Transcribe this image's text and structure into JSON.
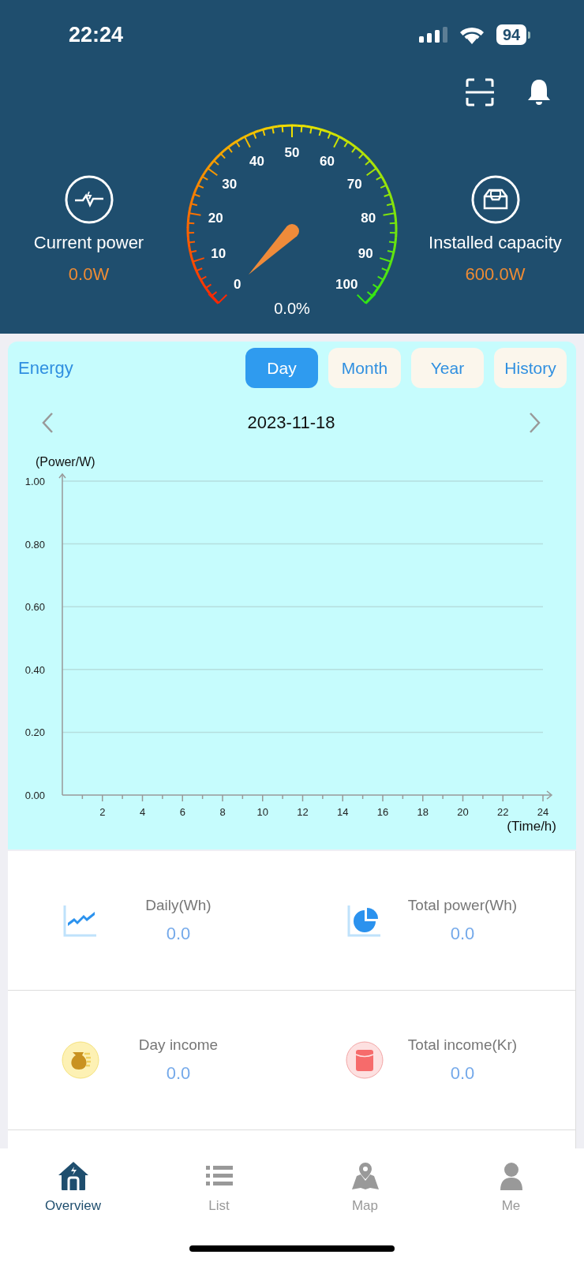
{
  "status_bar": {
    "time": "22:24",
    "battery": "94"
  },
  "gauge": {
    "scale_labels": [
      "0",
      "10",
      "20",
      "30",
      "40",
      "50",
      "60",
      "70",
      "80",
      "90",
      "100"
    ],
    "reading": "0.0%"
  },
  "current_power": {
    "label": "Current power",
    "value": "0.0W"
  },
  "installed_capacity": {
    "label": "Installed capacity",
    "value": "600.0W"
  },
  "energy": {
    "title": "Energy",
    "tabs": [
      {
        "label": "Day",
        "selected": true
      },
      {
        "label": "Month",
        "selected": false
      },
      {
        "label": "Year",
        "selected": false
      },
      {
        "label": "History",
        "selected": false
      }
    ],
    "date": "2023-11-18",
    "chart_data": {
      "type": "line",
      "grid": true,
      "xlabel": "(Time/h)",
      "ylabel": "(Power/W)",
      "xlim": [
        0,
        24
      ],
      "ylim": [
        0,
        1
      ],
      "xticks": [
        2,
        4,
        6,
        8,
        10,
        12,
        14,
        16,
        18,
        20,
        22,
        24
      ],
      "yticks": [
        {
          "value": 0,
          "label": "0.00"
        },
        {
          "value": 0.2,
          "label": "0.20"
        },
        {
          "value": 0.4,
          "label": "0.40"
        },
        {
          "value": 0.6,
          "label": "0.60"
        },
        {
          "value": 0.8,
          "label": "0.80"
        },
        {
          "value": 1,
          "label": "1.00"
        }
      ]
    }
  },
  "stats": [
    {
      "label": "Daily(Wh)",
      "value": "0.0"
    },
    {
      "label": "Total power(Wh)",
      "value": "0.0"
    },
    {
      "label": "Day income",
      "value": "0.0"
    },
    {
      "label": "Total income(Kr)",
      "value": "0.0"
    }
  ],
  "nav": [
    {
      "label": "Overview",
      "selected": true
    },
    {
      "label": "List",
      "selected": false
    },
    {
      "label": "Map",
      "selected": false
    },
    {
      "label": "Me",
      "selected": false
    }
  ]
}
